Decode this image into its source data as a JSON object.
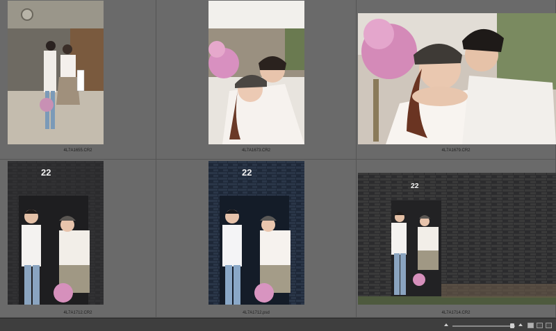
{
  "thumbnails": [
    {
      "filename": "4L7A1655.CR2"
    },
    {
      "filename": "4L7A1673.CR2"
    },
    {
      "filename": "4L7A1679.CR2"
    },
    {
      "filename": "4L7A1712.CR2"
    },
    {
      "filename": "4L7A1712.psd"
    },
    {
      "filename": "4L7A1714.CR2"
    }
  ],
  "zoom_slider": {
    "level": 0.95
  },
  "colors": {
    "background": "#5a5a5a",
    "cell": "#6a6a6a",
    "statusbar": "#3e3e3e",
    "filename_text": "#1e1e1e"
  },
  "icons": [
    "sort-triangle-icon",
    "grid-view-icon",
    "list-view-icon"
  ]
}
